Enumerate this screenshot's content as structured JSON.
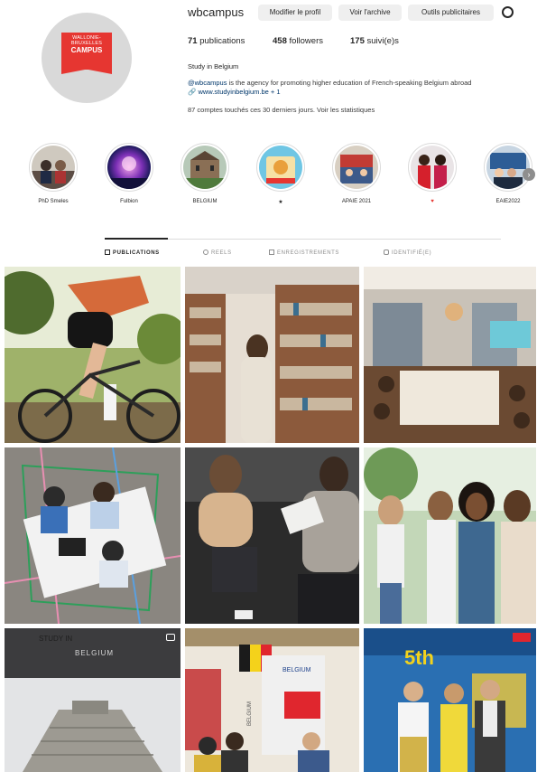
{
  "profile": {
    "username": "wbcampus",
    "avatar_logo_line1": "WALLONIE-",
    "avatar_logo_line1b": "BRUXELLES",
    "avatar_logo_line2": "CAMPUS",
    "buttons": {
      "edit": "Modifier le profil",
      "archive": "Voir l'archive",
      "tools": "Outils publicitaires"
    },
    "stats": {
      "posts_count": "71",
      "posts_label": "publications",
      "followers_count": "458",
      "followers_label": "followers",
      "following_count": "175",
      "following_label": "suivi(e)s"
    },
    "bio_name": "Study in Belgium",
    "bio_mention": "@wbcampus",
    "bio_text": " is the agency for promoting higher education of French-speaking Belgium abroad",
    "bio_link": "www.studyinbelgium.be + 1",
    "insights": "87 comptes touchés ces 30 derniers jours. Voir les statistiques"
  },
  "highlights": [
    {
      "label": "PhD Smeles"
    },
    {
      "label": "Fulbion"
    },
    {
      "label": "BELGIUM"
    },
    {
      "label": "★"
    },
    {
      "label": "APAIE 2021"
    },
    {
      "label": "♥"
    },
    {
      "label": "EAIE2022"
    }
  ],
  "tabs": {
    "posts": "PUBLICATIONS",
    "reels": "REELS",
    "saved": "ENREGISTREMENTS",
    "tagged": "IDENTIFIÉ(E)"
  },
  "posts": {
    "study_sign": "STUDY IN",
    "study_sign_b": "BELGIUM",
    "booth_sign": "BELGIUM",
    "booth_sign_b": "BELGIUM",
    "conf_banner": "5th"
  },
  "colors": {
    "accent": "#e63631",
    "text": "#262626",
    "muted": "#8e8e8e",
    "button_bg": "#efefef",
    "link": "#00376b"
  }
}
